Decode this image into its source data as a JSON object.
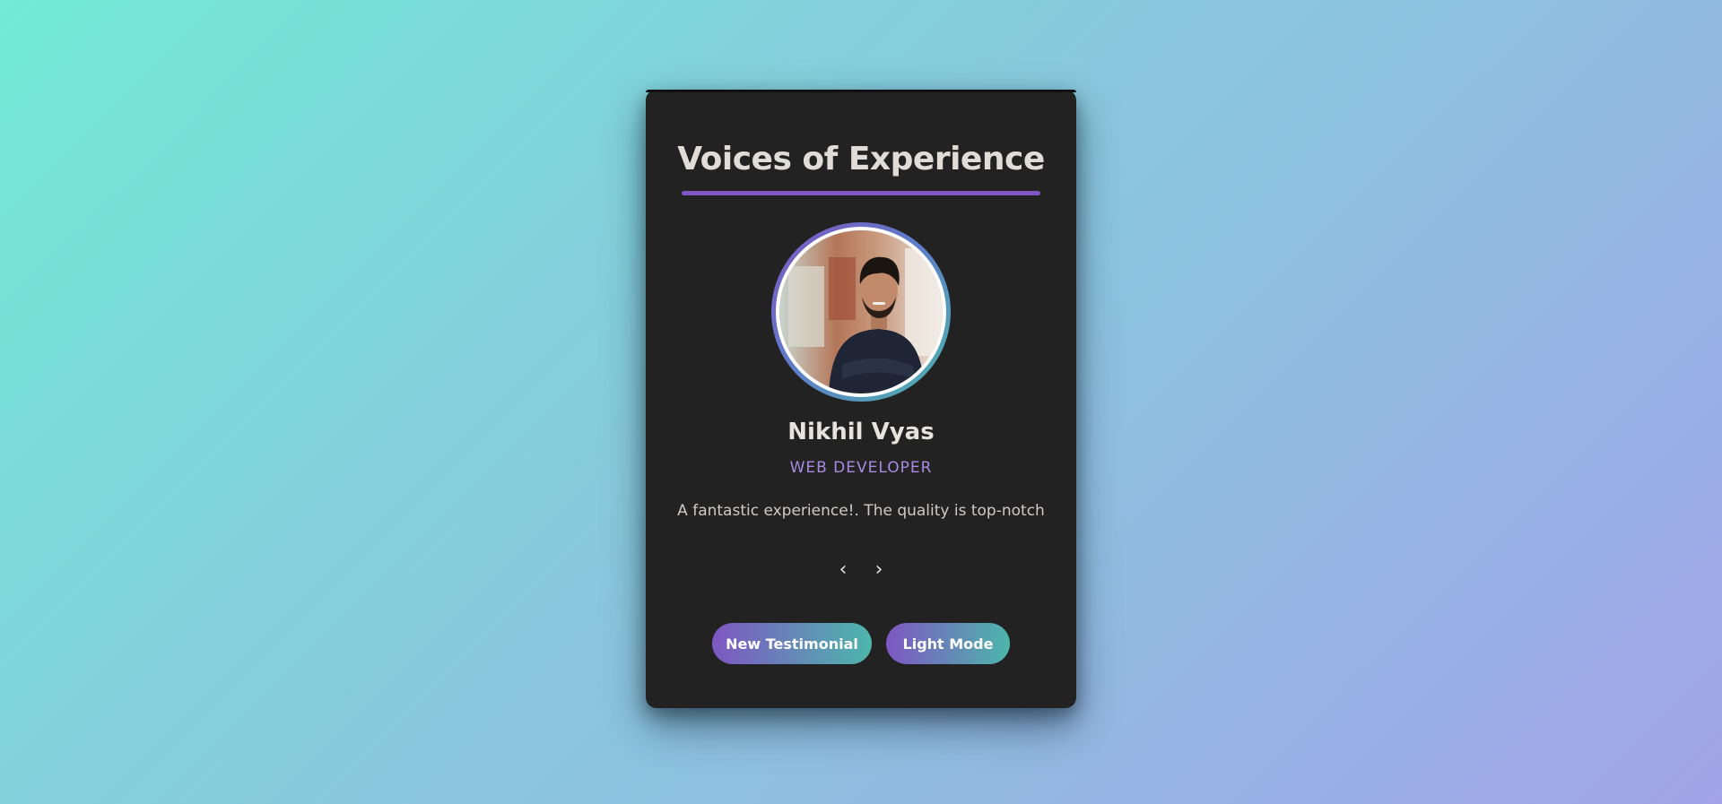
{
  "card": {
    "title": "Voices of Experience",
    "testimonial": {
      "name": "Nikhil Vyas",
      "role": "WEB DEVELOPER",
      "quote": "A fantastic experience!. The quality is top-notch",
      "avatar_icon": "person-photo"
    },
    "nav": {
      "prev_label": "‹",
      "next_label": "›"
    },
    "buttons": {
      "new_testimonial": "New Testimonial",
      "light_mode": "Light Mode"
    }
  },
  "colors": {
    "card_background": "#222222",
    "accent_purple": "#7e57c2",
    "accent_teal": "#4db6ac",
    "role_text": "#a68be0"
  }
}
